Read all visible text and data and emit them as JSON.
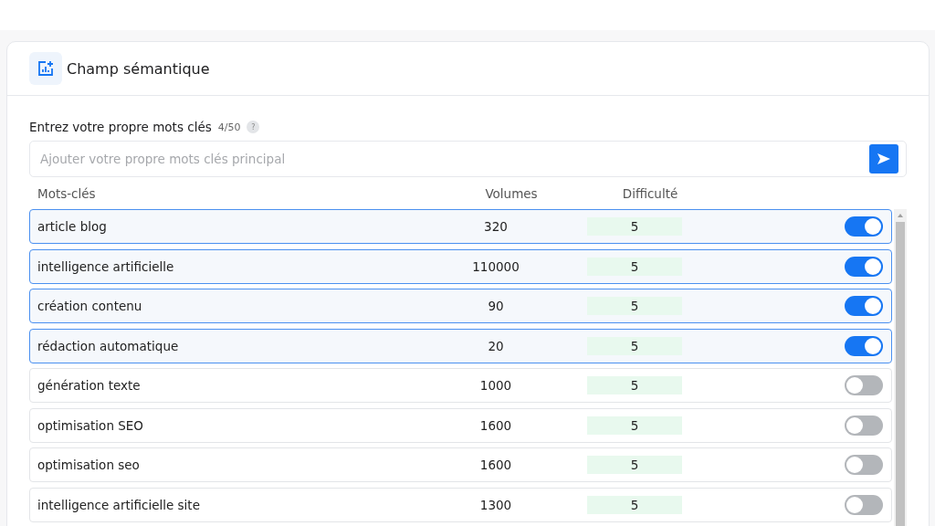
{
  "card": {
    "title": "Champ sémantique"
  },
  "keyword_input": {
    "label": "Entrez votre propre mots clés",
    "count": "4/50",
    "help": "?",
    "placeholder": "Ajouter votre propre mots clés principal"
  },
  "table": {
    "columns": [
      "Mots-clés",
      "Volumes",
      "Difficulté"
    ],
    "rows": [
      {
        "keyword": "article blog",
        "volume": "320",
        "difficulty": "5",
        "selected": true
      },
      {
        "keyword": "intelligence artificielle",
        "volume": "110000",
        "difficulty": "5",
        "selected": true
      },
      {
        "keyword": "création contenu",
        "volume": "90",
        "difficulty": "5",
        "selected": true
      },
      {
        "keyword": "rédaction automatique",
        "volume": "20",
        "difficulty": "5",
        "selected": true
      },
      {
        "keyword": "génération texte",
        "volume": "1000",
        "difficulty": "5",
        "selected": false
      },
      {
        "keyword": "optimisation SEO",
        "volume": "1600",
        "difficulty": "5",
        "selected": false
      },
      {
        "keyword": "optimisation seo",
        "volume": "1600",
        "difficulty": "5",
        "selected": false
      },
      {
        "keyword": "intelligence artificielle site",
        "volume": "1300",
        "difficulty": "5",
        "selected": false
      }
    ]
  }
}
